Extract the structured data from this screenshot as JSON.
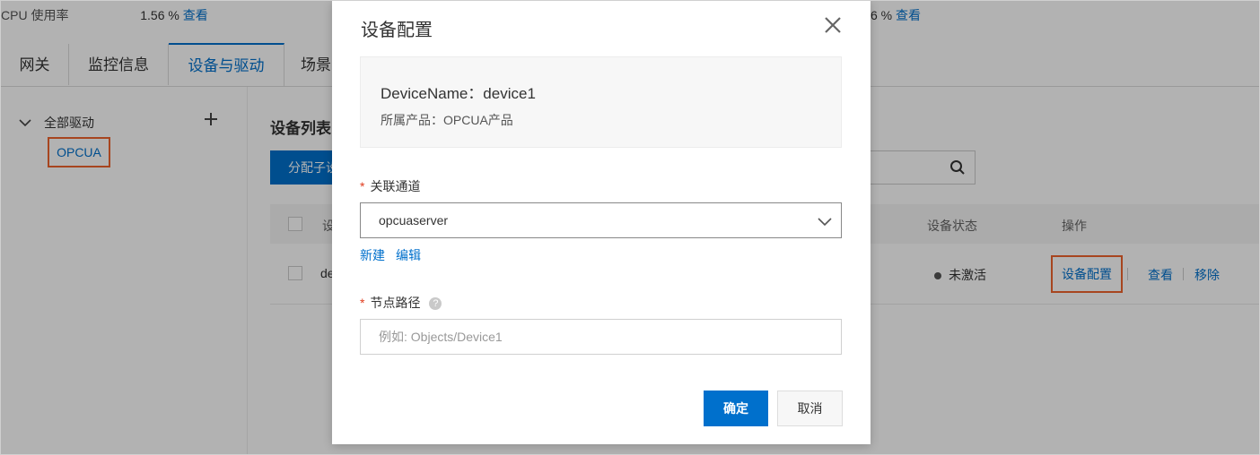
{
  "stats": [
    {
      "label": "CPU 使用率",
      "value": "1.56 %",
      "link": "查看"
    },
    {
      "value": "6 %",
      "link": "查看"
    }
  ],
  "tabs": [
    "网关",
    "监控信息",
    "设备与驱动",
    "场景"
  ],
  "active_tab": "设备与驱动",
  "tree": {
    "root": "全部驱动",
    "child": "OPCUA"
  },
  "device_list": {
    "title": "设备列表",
    "assign_button": "分配子设",
    "columns": {
      "name": "设",
      "status": "设备状态",
      "ops": "操作"
    },
    "rows": [
      {
        "name": "de",
        "status": "未激活",
        "ops": [
          "设备配置",
          "查看",
          "移除"
        ]
      }
    ]
  },
  "modal": {
    "title": "设备配置",
    "device_name": "DeviceName：device1",
    "product": "所属产品：OPCUA产品",
    "channel_label": "关联通道",
    "channel_value": "opcuaserver",
    "link_new": "新建",
    "link_edit": "编辑",
    "path_label": "节点路径",
    "path_placeholder": "例如: Objects/Device1",
    "ok": "确定",
    "cancel": "取消"
  },
  "colors": {
    "accent": "#0070cc",
    "highlight": "#f0642d",
    "required": "#e03c1e"
  }
}
